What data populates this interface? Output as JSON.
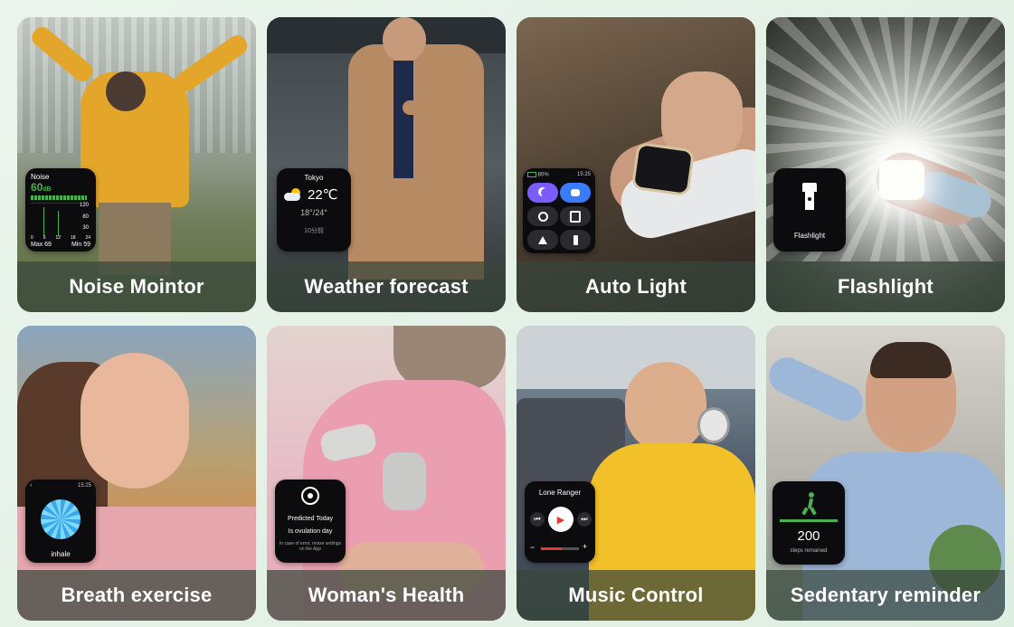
{
  "cards": [
    {
      "caption": "Noise Mointor",
      "watch": {
        "title": "Noise",
        "value": "60",
        "unit": "dB",
        "scale_top": "120",
        "scale_mid1": "80",
        "scale_mid2": "30",
        "x_labels": [
          "0",
          "6",
          "12",
          "18",
          "24"
        ],
        "max": "Max 69",
        "min": "Min 59"
      }
    },
    {
      "caption": "Weather forecast",
      "watch": {
        "city": "Tokyo",
        "temp": "22℃",
        "range": "18°/24°",
        "updated": "10分前"
      }
    },
    {
      "caption": "Auto Light",
      "watch": {
        "battery": "80%",
        "time": "15:25"
      }
    },
    {
      "caption": "Flashlight",
      "watch": {
        "label": "Flashlight"
      }
    },
    {
      "caption": "Breath exercise",
      "watch": {
        "time": "15:25",
        "label": "inhale"
      }
    },
    {
      "caption": "Woman's Health",
      "watch": {
        "title": "Predicted Today",
        "status": "Is ovulation day",
        "note": "In case of error, revise settings on the App"
      }
    },
    {
      "caption": "Music Control",
      "watch": {
        "track": "Lone Ranger"
      }
    },
    {
      "caption": "Sedentary reminder",
      "watch": {
        "steps": "200",
        "label": "steps remained"
      }
    }
  ],
  "colors": {
    "caption_bg": "#37463c",
    "accent_green": "#4caf50",
    "accent_blue": "#3b7bff",
    "accent_purple": "#7b5cff",
    "accent_red": "#e53935"
  }
}
